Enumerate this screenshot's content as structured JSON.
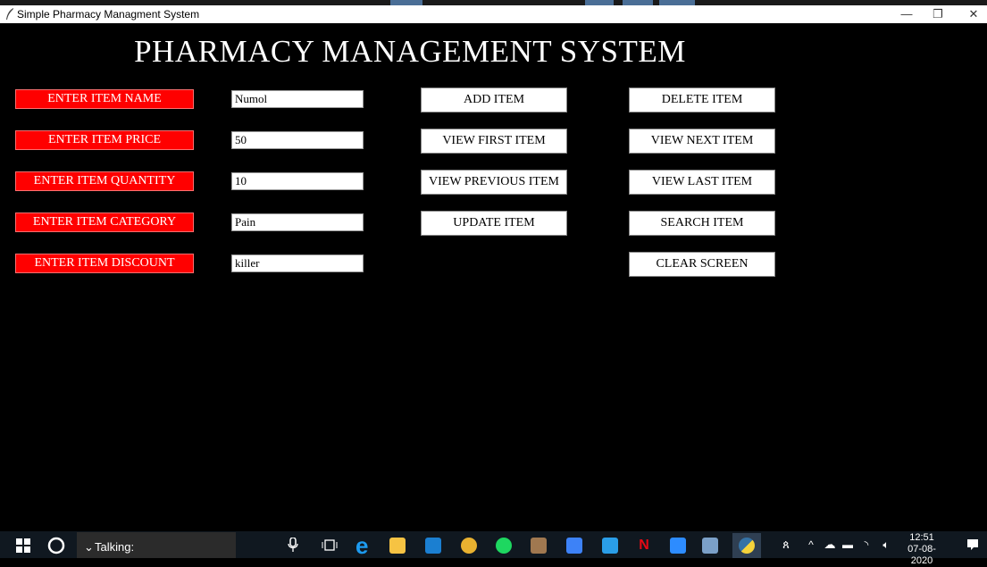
{
  "window": {
    "title": "Simple Pharmacy Managment System",
    "minimize": "—",
    "restore": "❐",
    "close": "✕"
  },
  "app": {
    "heading": "PHARMACY MANAGEMENT SYSTEM"
  },
  "fields": [
    {
      "label": "ENTER ITEM NAME",
      "value": "Numol"
    },
    {
      "label": "ENTER ITEM PRICE",
      "value": "50"
    },
    {
      "label": "ENTER ITEM QUANTITY",
      "value": "10"
    },
    {
      "label": "ENTER ITEM CATEGORY",
      "value": "Pain"
    },
    {
      "label": "ENTER ITEM DISCOUNT",
      "value": "killer"
    }
  ],
  "buttons_col1": [
    "ADD ITEM",
    "VIEW FIRST ITEM",
    "VIEW PREVIOUS ITEM",
    "UPDATE ITEM"
  ],
  "buttons_col2": [
    "DELETE ITEM",
    "VIEW NEXT ITEM",
    "VIEW LAST ITEM",
    "SEARCH ITEM",
    "CLEAR SCREEN"
  ],
  "taskbar": {
    "talking": "Talking:",
    "clock_time": "12:51",
    "clock_date": "07-08-2020",
    "start_icon": "windows-start-icon",
    "search_icon": "cortana-circle-icon"
  },
  "colors": {
    "label_bg": "#ff0000",
    "background": "#000000"
  }
}
